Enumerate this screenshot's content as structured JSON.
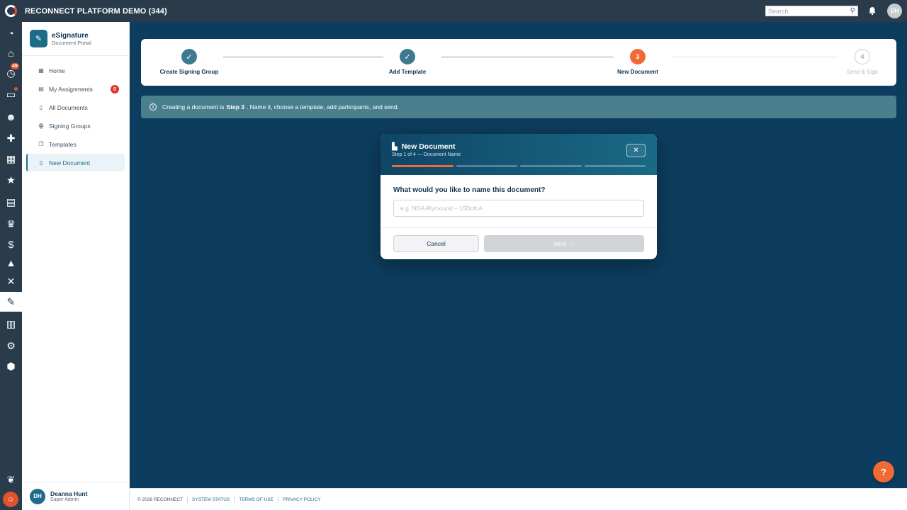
{
  "topbar": {
    "title": "RECONNECT PLATFORM DEMO (344)",
    "search_placeholder": "Search",
    "avatar_initials": "DH"
  },
  "rail": {
    "items": [
      {
        "icon": "dashboard-icon",
        "glyph": "◔"
      },
      {
        "icon": "bank-icon",
        "glyph": "⌂"
      },
      {
        "icon": "timer-icon",
        "glyph": "◷",
        "badge": "49"
      },
      {
        "icon": "chat-icon",
        "glyph": "▭",
        "dot": true
      },
      {
        "icon": "group-icon",
        "glyph": "☻"
      },
      {
        "icon": "medical-icon",
        "glyph": "✚"
      },
      {
        "icon": "calendar-icon",
        "glyph": "▦"
      },
      {
        "icon": "calendar-star-icon",
        "glyph": "★"
      },
      {
        "icon": "clipboard-icon",
        "glyph": "▤"
      },
      {
        "icon": "trophy-icon",
        "glyph": "♛"
      },
      {
        "icon": "dollar-icon",
        "glyph": "$"
      },
      {
        "icon": "graduation-icon",
        "glyph": "▲"
      },
      {
        "icon": "bandage-icon",
        "glyph": "✕"
      },
      {
        "icon": "esignature-icon",
        "glyph": "✎",
        "active": true
      },
      {
        "icon": "analytics-icon",
        "glyph": "▥"
      },
      {
        "icon": "settings-icon",
        "glyph": "⚙"
      },
      {
        "icon": "shield-gear-icon",
        "glyph": "⬢"
      }
    ],
    "bottom_icon": "bird-icon"
  },
  "sidebar": {
    "title": "eSignature",
    "subtitle": "Document Portal",
    "items": [
      {
        "label": "Home",
        "icon": "grid-icon",
        "glyph": "▦"
      },
      {
        "label": "My Assignments",
        "icon": "assignment-icon",
        "glyph": "▤",
        "badge": "0"
      },
      {
        "label": "All Documents",
        "icon": "document-icon",
        "glyph": "▯"
      },
      {
        "label": "Signing Groups",
        "icon": "people-icon",
        "glyph": "ꙮ"
      },
      {
        "label": "Templates",
        "icon": "copy-icon",
        "glyph": "❐"
      },
      {
        "label": "New Document",
        "icon": "new-document-icon",
        "glyph": "▯",
        "active": true
      }
    ],
    "user": {
      "initials": "DH",
      "name": "Deanna Hunt",
      "role": "Super Admin"
    }
  },
  "stepper": {
    "steps": [
      {
        "number": "✓",
        "label": "Create Signing Group",
        "state": "done"
      },
      {
        "number": "✓",
        "label": "Add Template",
        "state": "done"
      },
      {
        "number": "3",
        "label": "New Document",
        "state": "current"
      },
      {
        "number": "4",
        "label": "Send & Sign",
        "state": "todo"
      }
    ]
  },
  "info": {
    "prefix": "Creating a document is",
    "bold": "Step 3",
    "suffix": ". Name it, choose a template, add participants, and send."
  },
  "modal": {
    "title": "New Document",
    "subtitle": "Step 1 of 4 — Document Name",
    "progress_current": 1,
    "progress_total": 4,
    "question": "What would you like to name this document?",
    "input_placeholder": "e.g. NDA-Rymound – 15Dott A",
    "input_value": "",
    "cancel_label": "Cancel",
    "next_label": "Next →",
    "close_glyph": "✕"
  },
  "footer": {
    "copyright": "© 2026 RECONNECT",
    "links": [
      "SYSTEM STATUS",
      "TERMS OF USE",
      "PRIVACY POLICY"
    ]
  },
  "help_label": "?",
  "colors": {
    "accent": "#f26a33",
    "primary": "#1c6f8e",
    "background": "#0d3d5e",
    "topbar": "#2a3c4c"
  }
}
